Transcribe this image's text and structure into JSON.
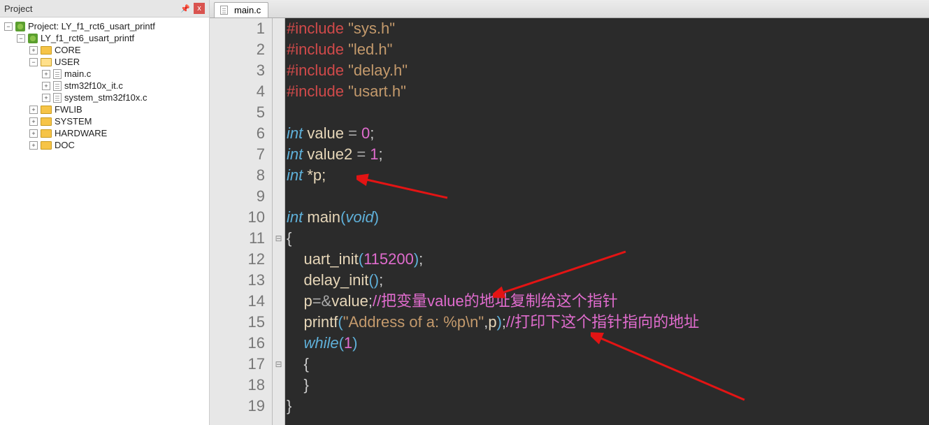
{
  "project_panel": {
    "title": "Project",
    "pin_glyph": "📌",
    "close_glyph": "x",
    "tree": {
      "root": {
        "toggle": "−",
        "label": "Project: LY_f1_rct6_usart_printf",
        "indent": 0
      },
      "target": {
        "toggle": "−",
        "label": "LY_f1_rct6_usart_printf",
        "indent": 18
      },
      "core": {
        "toggle": "+",
        "label": "CORE",
        "indent": 36
      },
      "user": {
        "toggle": "−",
        "label": "USER",
        "indent": 36
      },
      "f_main": {
        "toggle": "+",
        "label": "main.c",
        "indent": 54
      },
      "f_it": {
        "toggle": "+",
        "label": "stm32f10x_it.c",
        "indent": 54
      },
      "f_sys": {
        "toggle": "+",
        "label": "system_stm32f10x.c",
        "indent": 54
      },
      "fwlib": {
        "toggle": "+",
        "label": "FWLIB",
        "indent": 36
      },
      "system": {
        "toggle": "+",
        "label": "SYSTEM",
        "indent": 36
      },
      "hw": {
        "toggle": "+",
        "label": "HARDWARE",
        "indent": 36
      },
      "doc": {
        "toggle": "+",
        "label": "DOC",
        "indent": 36
      }
    }
  },
  "editor": {
    "tab_label": "main.c",
    "lines": {
      "n1": "1",
      "n2": "2",
      "n3": "3",
      "n4": "4",
      "n5": "5",
      "n6": "6",
      "n7": "7",
      "n8": "8",
      "n9": "9",
      "n10": "10",
      "n11": "11",
      "n12": "12",
      "n13": "13",
      "n14": "14",
      "n15": "15",
      "n16": "16",
      "n17": "17",
      "n18": "18",
      "n19": "19"
    },
    "fold": {
      "f11": "⊟",
      "f17": "⊟"
    },
    "code": {
      "l1_inc": "#include ",
      "l1_str": "\"sys.h\"",
      "l2_inc": "#include ",
      "l2_str": "\"led.h\"",
      "l3_inc": "#include ",
      "l3_str": "\"delay.h\"",
      "l4_inc": "#include ",
      "l4_str": "\"usart.h\"",
      "l6_kw": "int",
      "l6_id": " value ",
      "l6_op": "=",
      "l6_num": " 0",
      "l6_sc": ";",
      "l7_kw": "int",
      "l7_id": " value2 ",
      "l7_op": "=",
      "l7_num": " 1",
      "l7_sc": ";",
      "l8_kw": "int",
      "l8_rest": " *p;",
      "l10_kw": "int",
      "l10_fn": " main",
      "l10_lp": "(",
      "l10_void": "void",
      "l10_rp": ")",
      "l11_br": "{",
      "l12_pad": "    ",
      "l12_fn": "uart_init",
      "l12_lp": "(",
      "l12_num": "115200",
      "l12_rp": ")",
      "l12_sc": ";",
      "l13_pad": "    ",
      "l13_fn": "delay_init",
      "l13_lp": "(",
      "l13_rp": ")",
      "l13_sc": ";",
      "l14_pad": "    ",
      "l14_lhs": "p",
      "l14_op": "=&",
      "l14_rhs": "value",
      "l14_sc": ";",
      "l14_cmt": "//把变量value的地址复制给这个指针",
      "l15_pad": "    ",
      "l15_fn": "printf",
      "l15_lp": "(",
      "l15_str": "\"Address of a: %p\\n\"",
      "l15_comma": ",",
      "l15_arg": "p",
      "l15_rp": ")",
      "l15_sc": ";",
      "l15_cmt": "//打印下这个指针指向的地址",
      "l16_pad": "    ",
      "l16_kw": "while",
      "l16_lp": "(",
      "l16_num": "1",
      "l16_rp": ")",
      "l17_pad": "    ",
      "l17_br": "{",
      "l18_pad": "    ",
      "l18_br": "}",
      "l19_br": "}"
    }
  }
}
